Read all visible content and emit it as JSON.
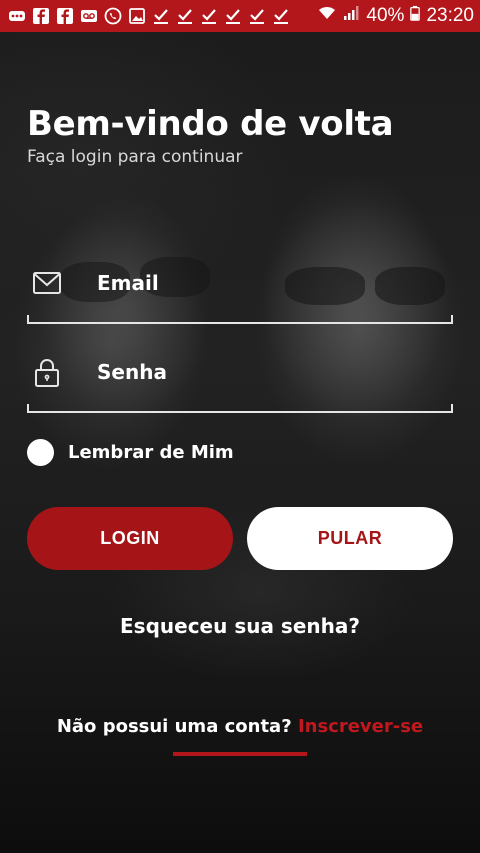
{
  "status_bar": {
    "battery": "40%",
    "time": "23:20",
    "left_icons": [
      "more-icon",
      "facebook-icon",
      "facebook-icon",
      "voicemail-icon",
      "whatsapp-icon",
      "image-icon",
      "check-icon",
      "check-icon",
      "check-icon",
      "check-icon",
      "check-icon",
      "check-icon"
    ],
    "background_color": "#b3161b"
  },
  "header": {
    "title": "Bem-vindo de volta",
    "subtitle": "Faça login para continuar"
  },
  "form": {
    "email_placeholder": "Email",
    "password_placeholder": "Senha",
    "remember_label": "Lembrar de Mim"
  },
  "buttons": {
    "login_label": "LOGIN",
    "skip_label": "PULAR"
  },
  "links": {
    "forgot": "Esqueceu sua senha?",
    "no_account": "Não possui uma conta?",
    "signup": "Inscrever-se"
  },
  "colors": {
    "accent": "#a51518",
    "text": "#ffffff"
  }
}
